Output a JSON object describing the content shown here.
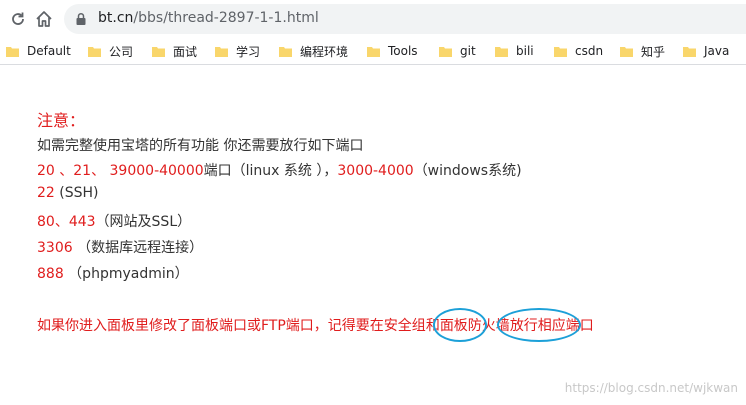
{
  "browser": {
    "url_host": "bt.cn",
    "url_path": "/bbs/thread-2897-1-1.html",
    "bookmarks": [
      "Default",
      "公司",
      "面试",
      "学习",
      "编程环境",
      "Tools",
      "git",
      "bili",
      "csdn",
      "知乎",
      "Java"
    ]
  },
  "post": {
    "title": "注意：",
    "intro": "如需完整使用宝塔的所有功能 你还需要放行如下端口",
    "ports_line": {
      "red1": "20 、21、 39000-40000",
      "text1": "端口（linux 系统 ），",
      "red2": "3000-4000",
      "text2": "（windows系统)"
    },
    "ssh": {
      "port": "22",
      "desc": " (SSH)"
    },
    "web": {
      "port": "80、443",
      "desc": "（网站及SSL）"
    },
    "db": {
      "port": "3306",
      "desc": " （数据库远程连接）"
    },
    "pma": {
      "port": "888",
      "desc": "  （phpmyadmin）"
    },
    "note": {
      "part1": "如果你进入面板里修改了面板端口或FTP端口，记得要在",
      "sg": "安全组",
      "and": "和",
      "fw": "面板防火墙",
      "part2": "放行相应端口"
    }
  },
  "watermark": "https://blog.csdn.net/wjkwan",
  "colors": {
    "highlight_red": "#e01d1d",
    "annotation_circle": "#1ca0d8",
    "folder_yellow": "#f9d66b"
  }
}
